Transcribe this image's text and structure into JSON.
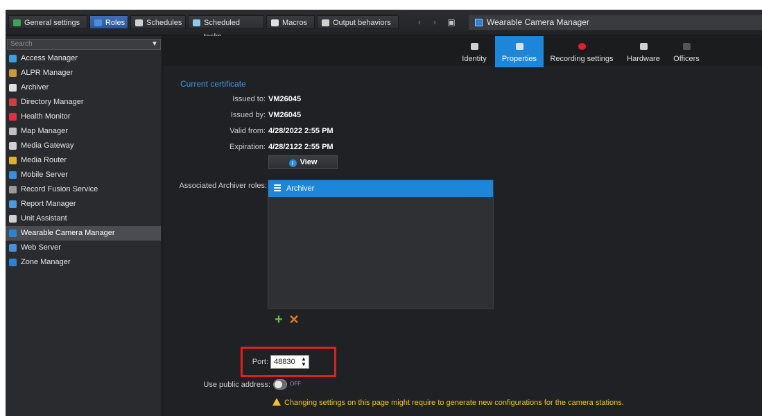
{
  "topbar": {
    "tabs": [
      {
        "label": "General settings",
        "icon": "general-settings-icon",
        "color": "#3aa655"
      },
      {
        "label": "Roles",
        "icon": "roles-icon",
        "color": "#4a8ee0",
        "active": true
      },
      {
        "label": "Schedules",
        "icon": "schedules-icon",
        "color": "#d0d0d0"
      },
      {
        "label": "Scheduled tasks",
        "icon": "scheduled-tasks-icon",
        "color": "#8ec8f0"
      },
      {
        "label": "Macros",
        "icon": "macros-icon",
        "color": "#e0e0e0"
      },
      {
        "label": "Output behaviors",
        "icon": "output-behaviors-icon",
        "color": "#d0d0d0"
      }
    ],
    "window_title": "Wearable Camera Manager"
  },
  "sidebar": {
    "search_placeholder": "Search",
    "items": [
      {
        "label": "Access Manager",
        "icon": "access-manager-icon",
        "color": "#3aa0e0"
      },
      {
        "label": "ALPR Manager",
        "icon": "alpr-manager-icon",
        "color": "#c89a3a"
      },
      {
        "label": "Archiver",
        "icon": "archiver-icon",
        "color": "#e0e0e0"
      },
      {
        "label": "Directory Manager",
        "icon": "directory-manager-icon",
        "color": "#d04040"
      },
      {
        "label": "Health Monitor",
        "icon": "health-monitor-icon",
        "color": "#e03040"
      },
      {
        "label": "Map Manager",
        "icon": "map-manager-icon",
        "color": "#c0c0c0"
      },
      {
        "label": "Media Gateway",
        "icon": "media-gateway-icon",
        "color": "#d0d0d0"
      },
      {
        "label": "Media Router",
        "icon": "media-router-icon",
        "color": "#e0b030"
      },
      {
        "label": "Mobile Server",
        "icon": "mobile-server-icon",
        "color": "#3a8ee0"
      },
      {
        "label": "Record Fusion Service",
        "icon": "record-fusion-service-icon",
        "color": "#9a9a9a"
      },
      {
        "label": "Report Manager",
        "icon": "report-manager-icon",
        "color": "#4a9ae0"
      },
      {
        "label": "Unit Assistant",
        "icon": "unit-assistant-icon",
        "color": "#d0d0d0"
      },
      {
        "label": "Wearable Camera Manager",
        "icon": "wearable-camera-manager-icon",
        "color": "#2c82d6",
        "selected": true
      },
      {
        "label": "Web Server",
        "icon": "web-server-icon",
        "color": "#4a8ee0"
      },
      {
        "label": "Zone Manager",
        "icon": "zone-manager-icon",
        "color": "#2c82d6"
      }
    ]
  },
  "role_tabs": [
    {
      "label": "Identity",
      "icon": "identity-icon"
    },
    {
      "label": "Properties",
      "icon": "properties-icon",
      "active": true
    },
    {
      "label": "Recording settings",
      "icon": "recording-settings-icon"
    },
    {
      "label": "Hardware",
      "icon": "hardware-icon"
    },
    {
      "label": "Officers",
      "icon": "officers-icon"
    }
  ],
  "certificate": {
    "section_title": "Current certificate",
    "issued_to_label": "Issued to:",
    "issued_to": "VM26045",
    "issued_by_label": "Issued by:",
    "issued_by": "VM26045",
    "valid_from_label": "Valid from:",
    "valid_from": "4/28/2022 2:55 PM",
    "expiration_label": "Expiration:",
    "expiration": "4/28/2122 2:55 PM",
    "view_button": "View"
  },
  "archiver_roles": {
    "label": "Associated Archiver roles:",
    "items": [
      "Archiver"
    ]
  },
  "port": {
    "label": "Port:",
    "value": "48830"
  },
  "public_address": {
    "label": "Use public address:",
    "state": "OFF"
  },
  "warning": "Changing settings on this page might require to generate new configurations for the camera stations."
}
